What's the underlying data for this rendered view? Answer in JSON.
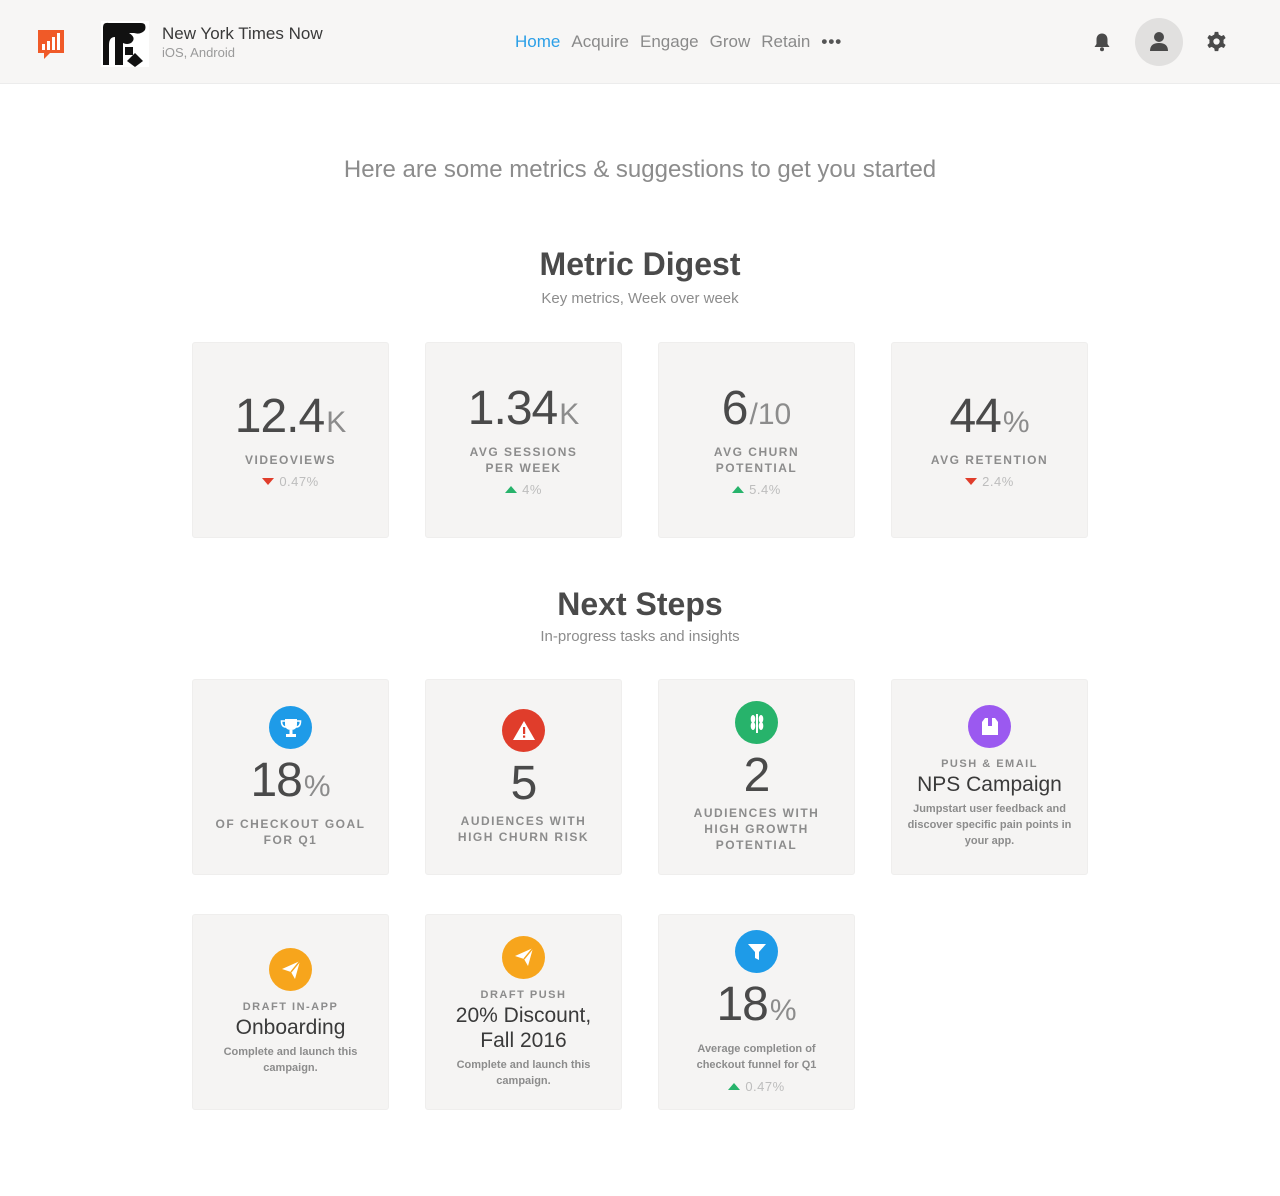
{
  "header": {
    "app_name": "New York Times Now",
    "app_platforms": "iOS, Android",
    "nav": [
      "Home",
      "Acquire",
      "Engage",
      "Grow",
      "Retain"
    ],
    "nav_more": "•••",
    "active_nav": "Home"
  },
  "intro": "Here are some metrics & suggestions to get you started",
  "digest": {
    "title": "Metric Digest",
    "subtitle": "Key metrics, Week over week",
    "cards": [
      {
        "value": "12.4",
        "unit": "K",
        "label": "VIDEOVIEWS",
        "direction": "down",
        "delta": "0.47%"
      },
      {
        "value": "1.34",
        "unit": "K",
        "label": "AVG SESSIONS PER WEEK",
        "direction": "up",
        "delta": "4%"
      },
      {
        "value": "6",
        "unit": "/10",
        "label": "AVG CHURN POTENTIAL",
        "direction": "up",
        "delta": "5.4%"
      },
      {
        "value": "44",
        "unit": "%",
        "label": "AVG RETENTION",
        "direction": "down",
        "delta": "2.4%"
      }
    ]
  },
  "next_steps": {
    "title": "Next Steps",
    "subtitle": "In-progress tasks and insights",
    "goal": {
      "icon": "trophy-icon",
      "color": "#1e9be8",
      "value": "18",
      "unit": "%",
      "label": "OF CHECKOUT GOAL FOR Q1"
    },
    "churn": {
      "icon": "warning-icon",
      "color": "#e03d2b",
      "value": "5",
      "label": "AUDIENCES WITH HIGH CHURN RISK"
    },
    "growth": {
      "icon": "wheat-icon",
      "color": "#27b36b",
      "value": "2",
      "label": "AUDIENCES WITH HIGH GROWTH POTENTIAL"
    },
    "nps": {
      "icon": "box-icon",
      "color": "#9b59f0",
      "eyebrow": "PUSH & EMAIL",
      "title": "NPS Campaign",
      "desc": "Jumpstart user feedback and discover specific pain points in your app."
    },
    "onboarding": {
      "icon": "paper-plane-icon",
      "color": "#f7a51c",
      "eyebrow": "DRAFT IN-APP",
      "title": "Onboarding",
      "desc": "Complete and launch this campaign."
    },
    "discount": {
      "icon": "paper-plane-icon",
      "color": "#f7a51c",
      "eyebrow": "DRAFT PUSH",
      "title": "20% Discount, Fall 2016",
      "desc": "Complete and launch this campaign."
    },
    "funnel": {
      "icon": "funnel-icon",
      "color": "#1e9be8",
      "value": "18",
      "unit": "%",
      "desc": "Average completion of checkout funnel for Q1",
      "direction": "up",
      "delta": "0.47%"
    }
  }
}
